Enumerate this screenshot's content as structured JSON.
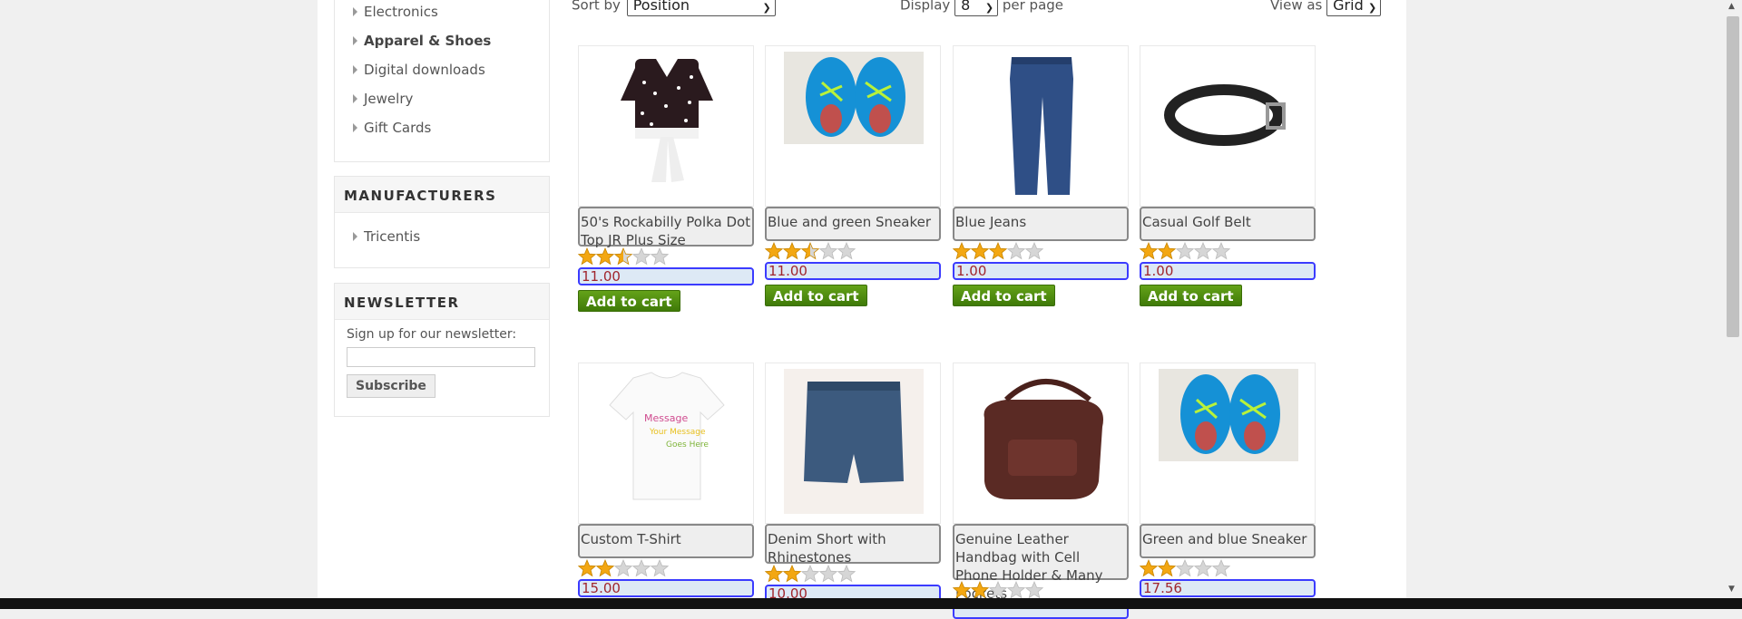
{
  "categories": {
    "items": [
      {
        "label": "Electronics",
        "active": false
      },
      {
        "label": "Apparel & Shoes",
        "active": true
      },
      {
        "label": "Digital downloads",
        "active": false
      },
      {
        "label": "Jewelry",
        "active": false
      },
      {
        "label": "Gift Cards",
        "active": false
      }
    ]
  },
  "manufacturers": {
    "title": "MANUFACTURERS",
    "items": [
      {
        "label": "Tricentis"
      }
    ]
  },
  "newsletter": {
    "title": "NEWSLETTER",
    "prompt": "Sign up for our newsletter:",
    "email_value": "",
    "subscribe_label": "Subscribe"
  },
  "toolbar": {
    "sort_label": "Sort by",
    "sort_value": "Position",
    "display_label": "Display",
    "display_value": "8",
    "per_page_label": "per page",
    "view_label": "View as",
    "view_value": "Grid"
  },
  "products": [
    {
      "title": "50's Rockabilly Polka Dot Top JR Plus Size",
      "rating": 2.5,
      "price": "11.00",
      "add_label": "Add to cart",
      "image": "polka-dot-top-image"
    },
    {
      "title": "Blue and green Sneaker",
      "rating": 2.5,
      "price": "11.00",
      "add_label": "Add to cart",
      "image": "blue-sneaker-image"
    },
    {
      "title": "Blue Jeans",
      "rating": 3,
      "price": "1.00",
      "add_label": "Add to cart",
      "image": "blue-jeans-image"
    },
    {
      "title": "Casual Golf Belt",
      "rating": 2,
      "price": "1.00",
      "add_label": "Add to cart",
      "image": "golf-belt-image"
    },
    {
      "title": "Custom T-Shirt",
      "rating": 2,
      "price": "15.00",
      "add_label": "",
      "image": "tshirt-image",
      "shirt_text": [
        "Message",
        "Your Message",
        "Goes Here"
      ]
    },
    {
      "title": "Denim Short with Rhinestones",
      "rating": 2,
      "price": "10.00",
      "add_label": "",
      "image": "denim-shorts-image"
    },
    {
      "title": "Genuine Leather Handbag with Cell Phone Holder & Many Pockets",
      "rating": 2,
      "price": "",
      "add_label": "",
      "image": "leather-handbag-image"
    },
    {
      "title": "Green and blue Sneaker",
      "rating": 2,
      "price": "17.56",
      "add_label": "",
      "image": "blue-sneaker-image"
    }
  ],
  "colors": {
    "star_on": "#f3a712",
    "star_off": "#d6d6d6",
    "price": "#a0262d",
    "button": "#4f8a0d",
    "price_border": "#3b3bff"
  }
}
